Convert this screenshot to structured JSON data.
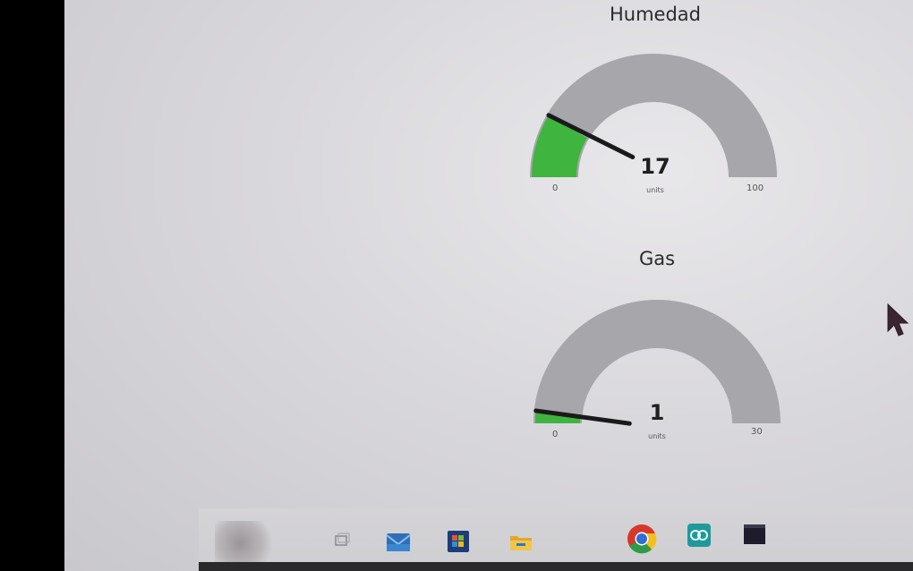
{
  "gauges": [
    {
      "title": "Humedad",
      "value": "17",
      "units": "units",
      "min": "0",
      "max": "100",
      "level": 0.17,
      "fill_color": "#3fb43f",
      "track_color": "#a7a6aa"
    },
    {
      "title": "Gas",
      "value": "1",
      "units": "units",
      "min": "0",
      "max": "30",
      "level": 0.033,
      "fill_color": "#3fb43f",
      "track_color": "#a7a6aa"
    }
  ],
  "taskbar": {
    "icons": [
      "widgets-icon",
      "task-view-icon",
      "mail-icon",
      "store-icon",
      "file-explorer-icon",
      "chrome-icon",
      "arduino-icon",
      "terminal-icon"
    ]
  }
}
